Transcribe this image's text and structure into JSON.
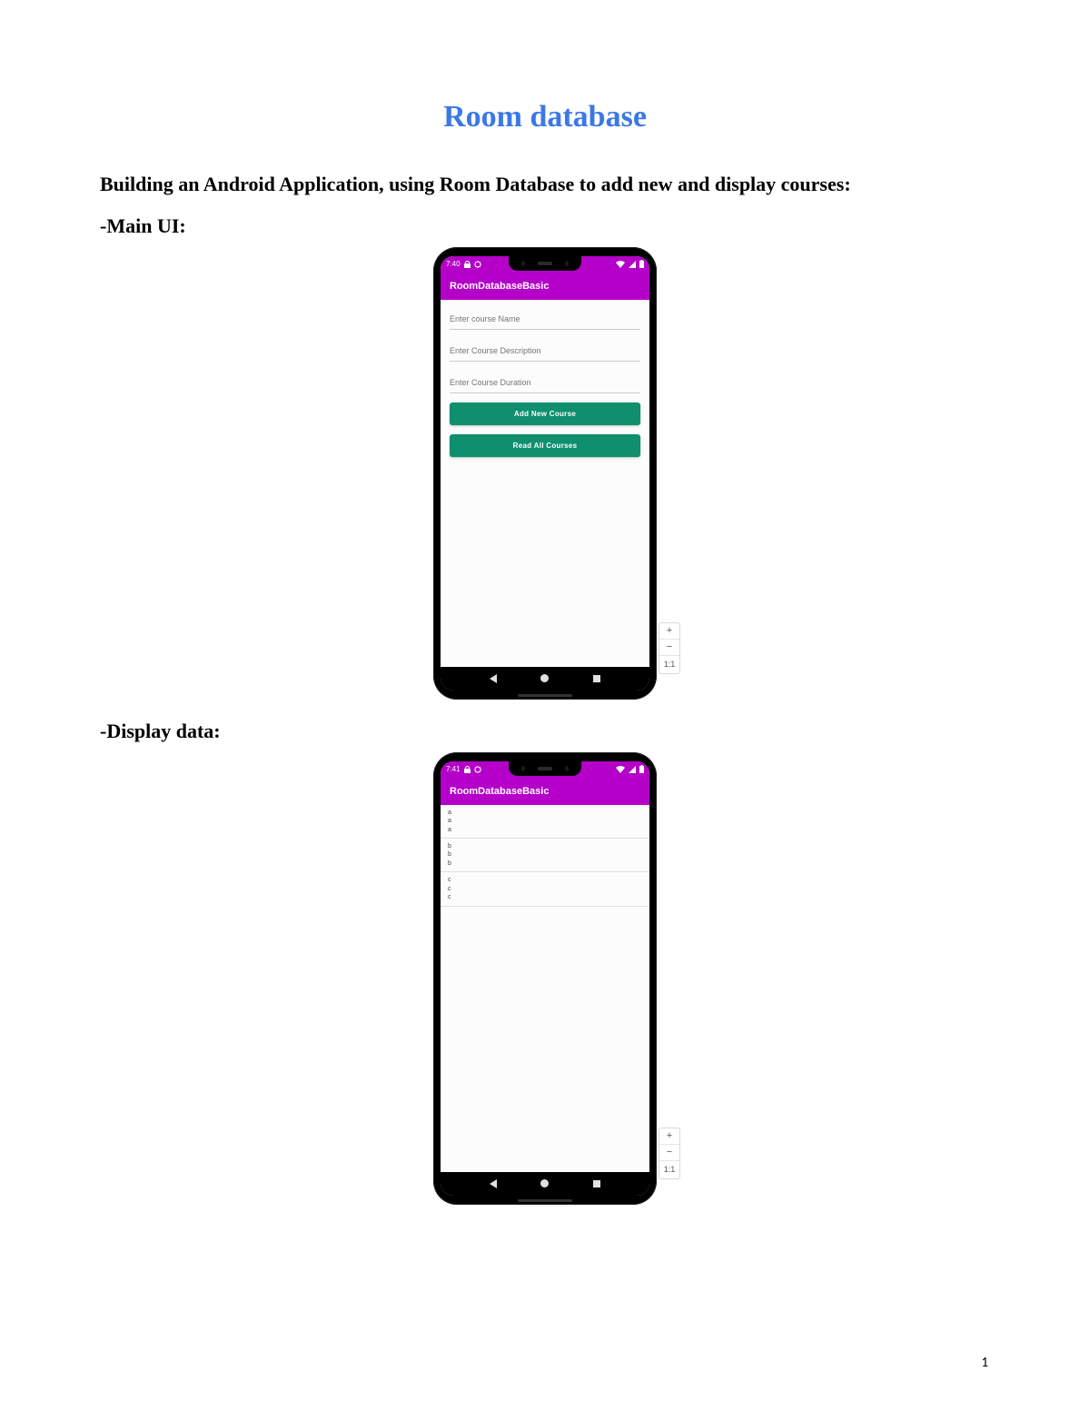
{
  "doc": {
    "title": "Room database",
    "intro": "Building an Android Application, using Room Database to add new and display courses:",
    "section_main_ui": "-Main UI:",
    "section_display": "-Display data:",
    "page_number": "1"
  },
  "phone1": {
    "status_time": "7:40",
    "app_bar_title": "RoomDatabaseBasic",
    "fields": {
      "name_placeholder": "Enter course Name",
      "desc_placeholder": "Enter Course Description",
      "duration_placeholder": "Enter Course Duration"
    },
    "buttons": {
      "add": "Add New Course",
      "read": "Read All Courses"
    }
  },
  "phone2": {
    "status_time": "7:41",
    "app_bar_title": "RoomDatabaseBasic",
    "items": [
      {
        "line1": "a",
        "line2": "a",
        "line3": "a"
      },
      {
        "line1": "b",
        "line2": "b",
        "line3": "b"
      },
      {
        "line1": "c",
        "line2": "c",
        "line3": "c"
      }
    ]
  },
  "emu": {
    "plus": "+",
    "minus": "−",
    "ratio": "1:1"
  },
  "colors": {
    "title_blue": "#3b78e7",
    "android_purple": "#b400c8",
    "button_green": "#0f8f6e"
  }
}
